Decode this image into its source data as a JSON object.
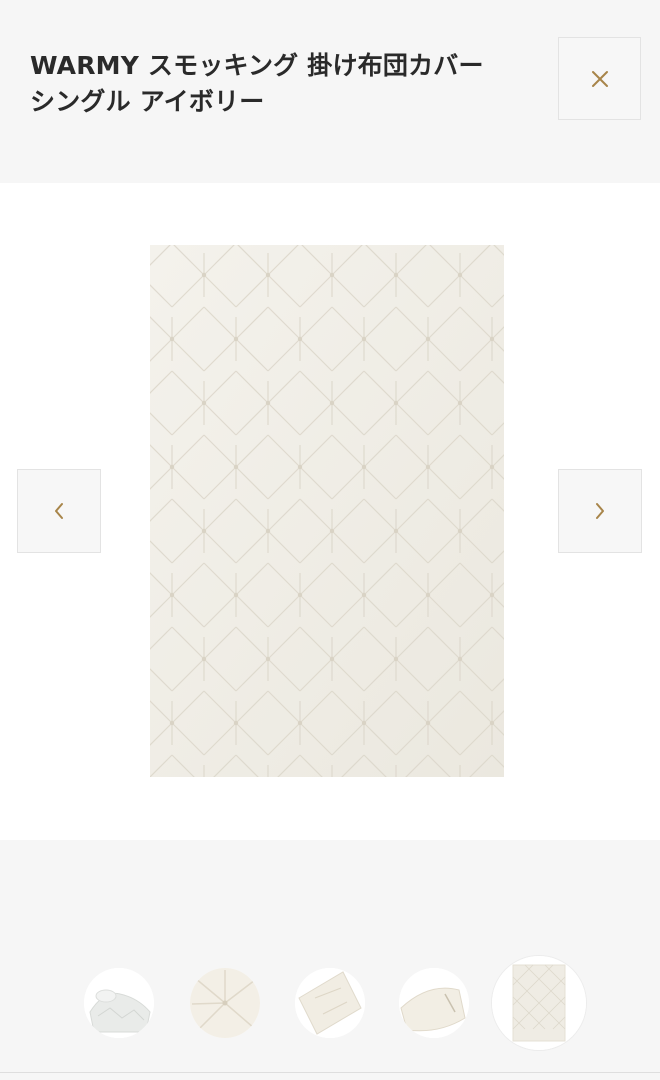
{
  "product": {
    "title": "WARMY スモッキング 掛け布団カバー シングル アイボリー"
  },
  "icons": {
    "close": "close-icon",
    "prev": "chevron-left-icon",
    "next": "chevron-right-icon"
  },
  "colors": {
    "accent": "#a8854a",
    "fabric": "#f1eee6",
    "background": "#f6f6f6"
  },
  "gallery": {
    "thumbnail_count": 5,
    "active_thumbnail": 5
  }
}
